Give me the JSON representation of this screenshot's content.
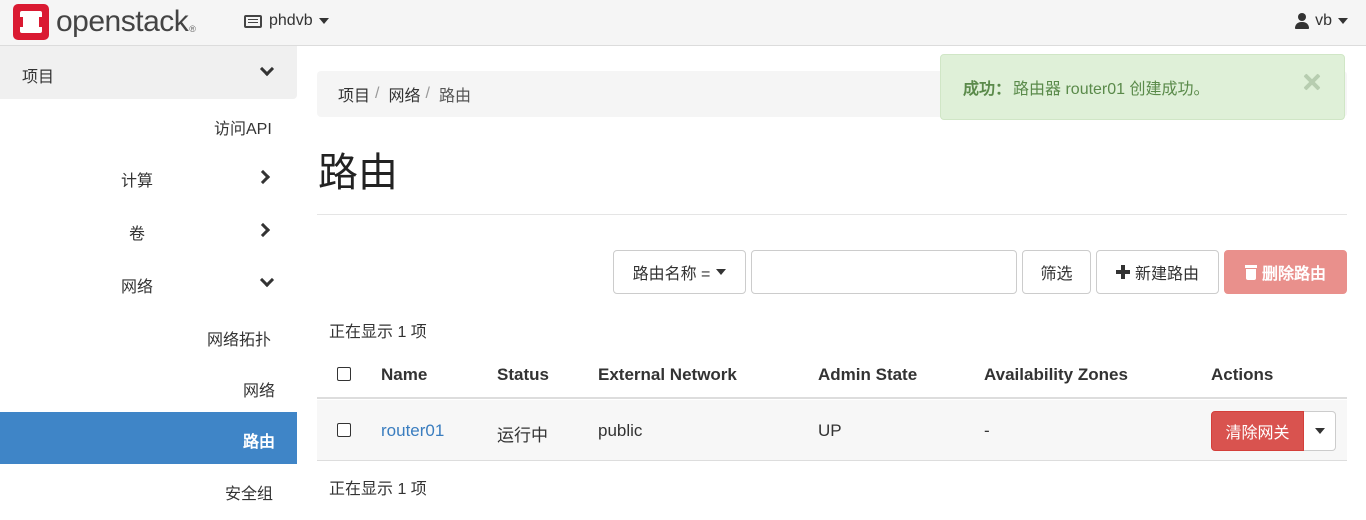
{
  "brand": {
    "name": "openstack",
    "reg": "®",
    "logo_color": "#da1a32"
  },
  "header": {
    "project_name": "phdvb",
    "user_name": "vb"
  },
  "sidebar": {
    "project_label": "项目",
    "items": [
      {
        "label": "访问API"
      },
      {
        "label": "计算"
      },
      {
        "label": "卷"
      },
      {
        "label": "网络"
      },
      {
        "label": "网络拓扑"
      },
      {
        "label": "网络"
      },
      {
        "label": "路由"
      },
      {
        "label": "安全组"
      }
    ],
    "active_color": "#3f85c7"
  },
  "breadcrumb": [
    "项目",
    "网络",
    "路由"
  ],
  "breadcrumb_sep": "/",
  "alert": {
    "prefix": "成功：",
    "message": "路由器 router01 创建成功。"
  },
  "page": {
    "title": "路由"
  },
  "toolbar": {
    "filter_field": "路由名称 =",
    "filter_value": "",
    "filter_button": "筛选",
    "create_button": "新建路由",
    "delete_button": "删除路由"
  },
  "table": {
    "count_top": "正在显示 1 项",
    "count_bottom": "正在显示 1 项",
    "columns": [
      "Name",
      "Status",
      "External Network",
      "Admin State",
      "Availability Zones",
      "Actions"
    ],
    "rows": [
      {
        "name": "router01",
        "status": "运行中",
        "external_network": "public",
        "admin_state": "UP",
        "availability_zones": "-",
        "action": "清除网关"
      }
    ]
  }
}
